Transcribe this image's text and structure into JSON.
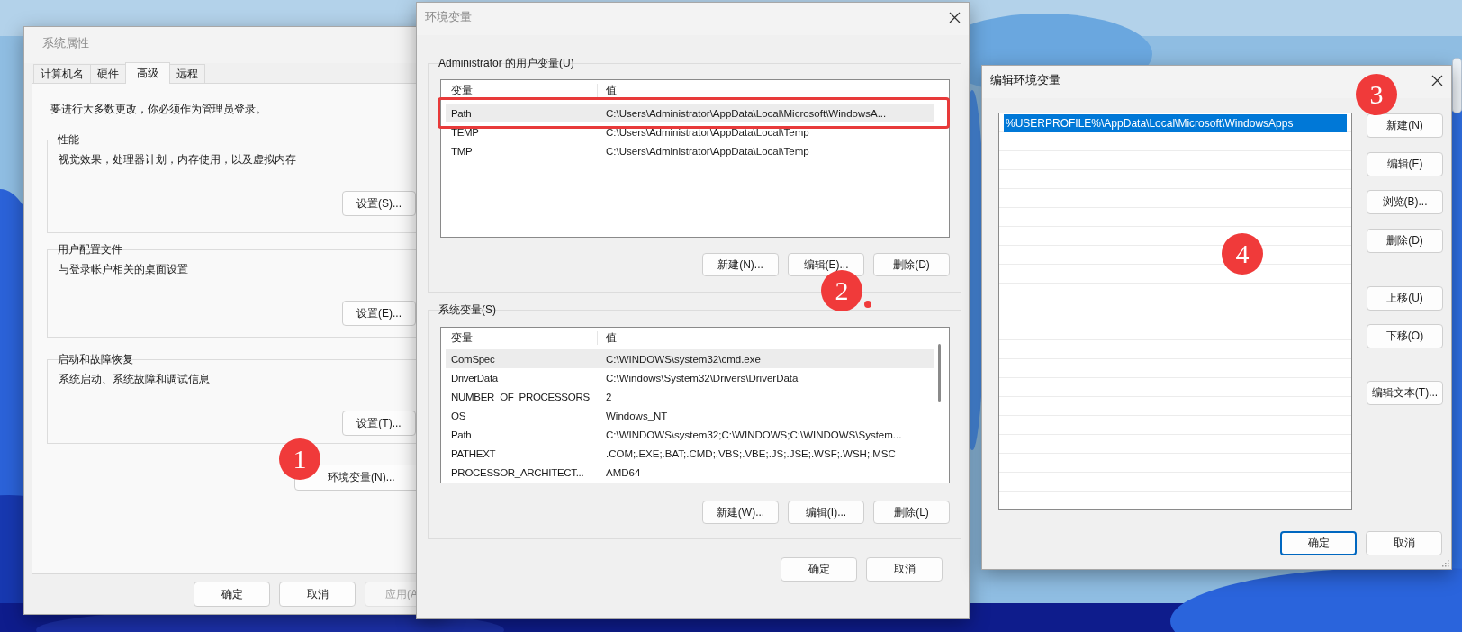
{
  "system_properties": {
    "title": "系统属性",
    "active": false,
    "tabs": [
      {
        "label": "计算机名",
        "selected": false
      },
      {
        "label": "硬件",
        "selected": false
      },
      {
        "label": "高级",
        "selected": true
      },
      {
        "label": "远程",
        "selected": false
      }
    ],
    "notice": "要进行大多数更改，你必须作为管理员登录。",
    "groups": [
      {
        "title": "性能",
        "description": "视觉效果，处理器计划，内存使用，以及虚拟内存",
        "button": "设置(S)..."
      },
      {
        "title": "用户配置文件",
        "description": "与登录帐户相关的桌面设置",
        "button": "设置(E)..."
      },
      {
        "title": "启动和故障恢复",
        "description": "系统启动、系统故障和调试信息",
        "button": "设置(T)..."
      }
    ],
    "env_button": "环境变量(N)...",
    "buttons": [
      {
        "label": "确定",
        "disabled": false
      },
      {
        "label": "取消",
        "disabled": false
      },
      {
        "label": "应用(A",
        "disabled": true
      }
    ]
  },
  "environment_variables": {
    "title": "环境变量",
    "active": false,
    "user_vars": {
      "title": "Administrator 的用户变量(U)",
      "columns": [
        "变量",
        "值"
      ],
      "rows": [
        {
          "name": "Path",
          "value": "C:\\Users\\Administrator\\AppData\\Local\\Microsoft\\WindowsA...",
          "selected": true
        },
        {
          "name": "TEMP",
          "value": "C:\\Users\\Administrator\\AppData\\Local\\Temp",
          "selected": false
        },
        {
          "name": "TMP",
          "value": "C:\\Users\\Administrator\\AppData\\Local\\Temp",
          "selected": false
        }
      ],
      "buttons": [
        "新建(N)...",
        "编辑(E)...",
        "删除(D)"
      ]
    },
    "system_vars": {
      "title": "系统变量(S)",
      "columns": [
        "变量",
        "值"
      ],
      "rows": [
        {
          "name": "ComSpec",
          "value": "C:\\WINDOWS\\system32\\cmd.exe",
          "selected": true
        },
        {
          "name": "DriverData",
          "value": "C:\\Windows\\System32\\Drivers\\DriverData",
          "selected": false
        },
        {
          "name": "NUMBER_OF_PROCESSORS",
          "value": "2",
          "selected": false
        },
        {
          "name": "OS",
          "value": "Windows_NT",
          "selected": false
        },
        {
          "name": "Path",
          "value": "C:\\WINDOWS\\system32;C:\\WINDOWS;C:\\WINDOWS\\System...",
          "selected": false
        },
        {
          "name": "PATHEXT",
          "value": ".COM;.EXE;.BAT;.CMD;.VBS;.VBE;.JS;.JSE;.WSF;.WSH;.MSC",
          "selected": false
        },
        {
          "name": "PROCESSOR_ARCHITECT...",
          "value": "AMD64",
          "selected": false
        }
      ],
      "buttons": [
        "新建(W)...",
        "编辑(I)...",
        "删除(L)"
      ]
    },
    "buttons": [
      "确定",
      "取消"
    ]
  },
  "edit_variable": {
    "title": "编辑环境变量",
    "active": true,
    "entries": [
      {
        "text": "%USERPROFILE%\\AppData\\Local\\Microsoft\\WindowsApps",
        "selected": true
      }
    ],
    "buttons": [
      "新建(N)",
      "编辑(E)",
      "浏览(B)...",
      "删除(D)",
      "上移(U)",
      "下移(O)",
      "编辑文本(T)..."
    ],
    "footer_buttons": [
      {
        "label": "确定",
        "default": true
      },
      {
        "label": "取消",
        "default": false
      }
    ]
  },
  "annotations": [
    {
      "kind": "badge",
      "label": "1"
    },
    {
      "kind": "frame"
    },
    {
      "kind": "badge",
      "label": "2"
    },
    {
      "kind": "dot"
    },
    {
      "kind": "badge",
      "label": "3"
    },
    {
      "kind": "badge",
      "label": "4"
    }
  ]
}
